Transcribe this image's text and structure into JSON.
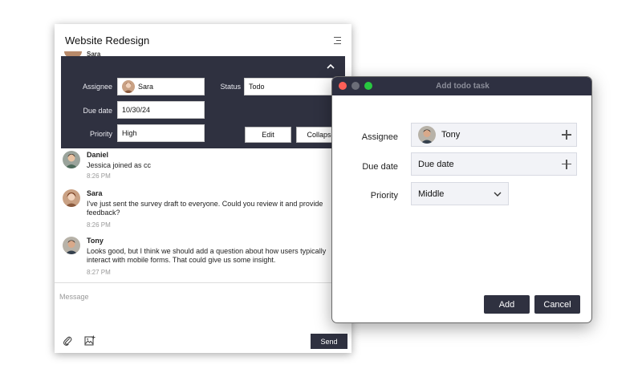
{
  "chat": {
    "title": "Website Redesign",
    "peek_name": "Sara",
    "task_panel": {
      "assignee_label": "Assignee",
      "assignee_value": "Sara",
      "status_label": "Status",
      "status_value": "Todo",
      "due_label": "Due date",
      "due_value": "10/30/24",
      "priority_label": "Priority",
      "priority_value": "High",
      "edit_label": "Edit",
      "collapse_label": "Collapse"
    },
    "messages": [
      {
        "name": "Daniel",
        "text": "Jessica joined as cc",
        "time": "8:26 PM"
      },
      {
        "name": "Sara",
        "text": "I've just sent the survey draft to everyone. Could you review it and provide feedback?",
        "time": "8:26 PM"
      },
      {
        "name": "Tony",
        "text": "Looks good, but I think we should add a question about how users typically interact with mobile forms. That could give us some insight.",
        "time": "8:27 PM"
      }
    ],
    "composer": {
      "placeholder": "Message",
      "send_label": "Send"
    }
  },
  "dialog": {
    "title": "Add todo task",
    "assignee_label": "Assignee",
    "assignee_value": "Tony",
    "due_label": "Due date",
    "due_value": "Due date",
    "priority_label": "Priority",
    "priority_value": "Middle",
    "add_label": "Add",
    "cancel_label": "Cancel"
  },
  "colors": {
    "panel_dark": "#2f3140",
    "traffic_red": "#ff5f57",
    "traffic_yellow": "#6b6d78",
    "traffic_green": "#28c840"
  }
}
